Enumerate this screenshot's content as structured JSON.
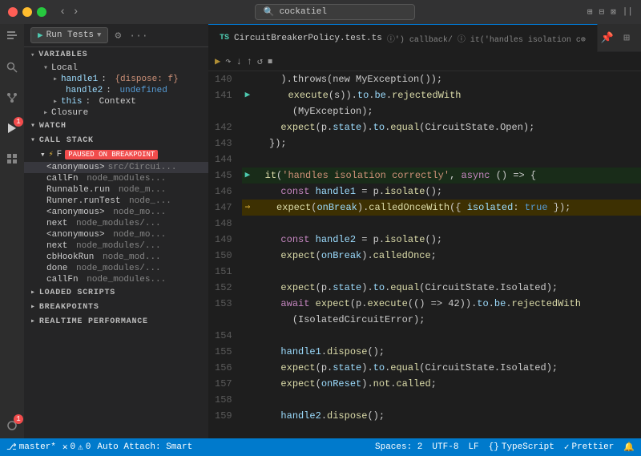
{
  "titleBar": {
    "searchPlaceholder": "cockatiel",
    "navBack": "‹",
    "navForward": "›"
  },
  "activityBar": {
    "icons": [
      {
        "name": "explorer-icon",
        "glyph": "⎇",
        "active": false
      },
      {
        "name": "search-icon",
        "glyph": "🔍",
        "active": false
      },
      {
        "name": "scm-icon",
        "glyph": "⑂",
        "active": false
      },
      {
        "name": "debug-icon",
        "glyph": "▷",
        "active": true
      },
      {
        "name": "extensions-icon",
        "glyph": "⬛",
        "active": false
      },
      {
        "name": "remote-icon",
        "glyph": "⌂",
        "active": false
      }
    ]
  },
  "sidebar": {
    "debugToolbar": {
      "runLabel": "Run Tests",
      "settingsIcon": "⚙",
      "moreIcon": "···"
    },
    "variables": {
      "header": "VARIABLES",
      "items": [
        {
          "label": "Local",
          "type": "group"
        },
        {
          "label": "handle1",
          "value": "{dispose: f}",
          "type": "var",
          "indent": 2
        },
        {
          "label": "handle2",
          "value": "undefined",
          "type": "var-undefined",
          "indent": 2
        },
        {
          "label": "this",
          "value": "Context",
          "type": "var",
          "indent": 2
        },
        {
          "label": "Closure",
          "type": "group",
          "indent": 1
        }
      ]
    },
    "watch": {
      "header": "WATCH"
    },
    "callStack": {
      "header": "CALL STACK",
      "thread": {
        "label": "F",
        "status": "PAUSED ON BREAKPOINT"
      },
      "frames": [
        {
          "name": "<anonymous>",
          "path": "src/Circui..."
        },
        {
          "name": "callFn",
          "path": "node_modules..."
        },
        {
          "name": "Runnable.run",
          "path": "node_m..."
        },
        {
          "name": "Runner.runTest",
          "path": "node_..."
        },
        {
          "name": "<anonymous>",
          "path": "node_mo..."
        },
        {
          "name": "next",
          "path": "node_modules/..."
        },
        {
          "name": "<anonymous>",
          "path": "node_mo..."
        },
        {
          "name": "next",
          "path": "node_modules/..."
        },
        {
          "name": "cbHookRun",
          "path": "node_mod..."
        },
        {
          "name": "done",
          "path": "node_modules/..."
        },
        {
          "name": "callFn",
          "path": "node_modules..."
        }
      ]
    },
    "loadedScripts": {
      "header": "LOADED SCRIPTS"
    },
    "breakpoints": {
      "header": "BREAKPOINTS"
    },
    "realtimePerformance": {
      "header": "REALTIME PERFORMANCE"
    }
  },
  "editor": {
    "tab": {
      "tsLabel": "TS",
      "filename": "CircuitBreakerPolicy.test.ts",
      "breadcrumb": "ⓘ') callback/ ⓘ it('handles isolation c⊕"
    },
    "debugToolbar": {
      "continue": "▶",
      "stepOver": "↷",
      "stepInto": "↓",
      "stepOut": "↑",
      "restart": "↺",
      "stop": "⏹"
    },
    "lines": [
      {
        "num": 140,
        "arrow": "",
        "content": [
          {
            "t": "op",
            "v": "    ).throws(new MyException());"
          }
        ]
      },
      {
        "num": 141,
        "arrow": "play",
        "content": [
          {
            "t": "fn",
            "v": "      execute"
          },
          {
            "t": "op",
            "v": "(s))."
          },
          {
            "t": "prop",
            "v": "to"
          },
          {
            "t": "op",
            "v": "."
          },
          {
            "t": "prop",
            "v": "be"
          },
          {
            "t": "op",
            "v": "."
          },
          {
            "t": "fn",
            "v": "rejectedWith"
          }
        ]
      },
      {
        "num": "",
        "arrow": "",
        "content": [
          {
            "t": "op",
            "v": "      (MyException);"
          }
        ]
      },
      {
        "num": 142,
        "arrow": "",
        "content": [
          {
            "t": "fn",
            "v": "    expect"
          },
          {
            "t": "op",
            "v": "(p."
          },
          {
            "t": "prop",
            "v": "state"
          },
          {
            "t": "op",
            "v": ")."
          },
          {
            "t": "prop",
            "v": "to"
          },
          {
            "t": "op",
            "v": "."
          },
          {
            "t": "fn",
            "v": "equal"
          },
          {
            "t": "op",
            "v": "(CircuitState.Open);"
          }
        ]
      },
      {
        "num": 143,
        "arrow": "",
        "content": [
          {
            "t": "op",
            "v": "  });"
          }
        ]
      },
      {
        "num": 144,
        "arrow": "",
        "content": [
          {
            "t": "op",
            "v": ""
          }
        ]
      },
      {
        "num": 145,
        "arrow": "play",
        "content": [
          {
            "t": "fn",
            "v": "  it"
          },
          {
            "t": "op",
            "v": "("
          },
          {
            "t": "str",
            "v": "'handles isolation correctly'"
          },
          {
            "t": "op",
            "v": ", "
          },
          {
            "t": "kw",
            "v": "async"
          },
          {
            "t": "op",
            "v": " () => {"
          }
        ],
        "highlight": "green"
      },
      {
        "num": 146,
        "arrow": "",
        "content": [
          {
            "t": "kw",
            "v": "    const"
          },
          {
            "t": "op",
            "v": " "
          },
          {
            "t": "var2",
            "v": "handle1"
          },
          {
            "t": "op",
            "v": " = p."
          },
          {
            "t": "fn",
            "v": "isolate"
          },
          {
            "t": "op",
            "v": "();"
          }
        ]
      },
      {
        "num": 147,
        "arrow": "debug",
        "content": [
          {
            "t": "fn",
            "v": "    expect"
          },
          {
            "t": "op",
            "v": "("
          },
          {
            "t": "var2",
            "v": "onBreak"
          },
          {
            "t": "op",
            "v": ")."
          },
          {
            "t": "fn",
            "v": "calledOnceWith"
          },
          {
            "t": "op",
            "v": "({ "
          },
          {
            "t": "prop",
            "v": "isolated"
          },
          {
            "t": "op",
            "v": ": "
          },
          {
            "t": "bool-val",
            "v": "true"
          },
          {
            "t": "op",
            "v": " });"
          }
        ],
        "highlight": "yellow"
      },
      {
        "num": 148,
        "arrow": "",
        "content": [
          {
            "t": "op",
            "v": ""
          }
        ]
      },
      {
        "num": 149,
        "arrow": "",
        "content": [
          {
            "t": "kw",
            "v": "    const"
          },
          {
            "t": "op",
            "v": " "
          },
          {
            "t": "var2",
            "v": "handle2"
          },
          {
            "t": "op",
            "v": " = p."
          },
          {
            "t": "fn",
            "v": "isolate"
          },
          {
            "t": "op",
            "v": "();"
          }
        ]
      },
      {
        "num": 150,
        "arrow": "",
        "content": [
          {
            "t": "fn",
            "v": "    expect"
          },
          {
            "t": "op",
            "v": "("
          },
          {
            "t": "var2",
            "v": "onBreak"
          },
          {
            "t": "op",
            "v": ")."
          },
          {
            "t": "fn",
            "v": "calledOnce"
          },
          {
            "t": "op",
            "v": ";"
          }
        ]
      },
      {
        "num": 151,
        "arrow": "",
        "content": [
          {
            "t": "op",
            "v": ""
          }
        ]
      },
      {
        "num": 152,
        "arrow": "",
        "content": [
          {
            "t": "fn",
            "v": "    expect"
          },
          {
            "t": "op",
            "v": "(p."
          },
          {
            "t": "prop",
            "v": "state"
          },
          {
            "t": "op",
            "v": ")."
          },
          {
            "t": "prop",
            "v": "to"
          },
          {
            "t": "op",
            "v": "."
          },
          {
            "t": "fn",
            "v": "equal"
          },
          {
            "t": "op",
            "v": "(CircuitState.Isolated);"
          }
        ]
      },
      {
        "num": 153,
        "arrow": "",
        "content": [
          {
            "t": "kw",
            "v": "    await"
          },
          {
            "t": "op",
            "v": " "
          },
          {
            "t": "fn",
            "v": "expect"
          },
          {
            "t": "op",
            "v": "(p."
          },
          {
            "t": "fn",
            "v": "execute"
          },
          {
            "t": "op",
            "v": "(() => 42))."
          },
          {
            "t": "prop",
            "v": "to"
          },
          {
            "t": "op",
            "v": "."
          },
          {
            "t": "prop",
            "v": "be"
          },
          {
            "t": "op",
            "v": "."
          },
          {
            "t": "fn",
            "v": "rejectedWith"
          }
        ]
      },
      {
        "num": "",
        "arrow": "",
        "content": [
          {
            "t": "op",
            "v": "      (IsolatedCircuitError);"
          }
        ]
      },
      {
        "num": 154,
        "arrow": "",
        "content": [
          {
            "t": "op",
            "v": ""
          }
        ]
      },
      {
        "num": 155,
        "arrow": "",
        "content": [
          {
            "t": "var2",
            "v": "    handle1"
          },
          {
            "t": "op",
            "v": "."
          },
          {
            "t": "fn",
            "v": "dispose"
          },
          {
            "t": "op",
            "v": "();"
          }
        ]
      },
      {
        "num": 156,
        "arrow": "",
        "content": [
          {
            "t": "fn",
            "v": "    expect"
          },
          {
            "t": "op",
            "v": "(p."
          },
          {
            "t": "prop",
            "v": "state"
          },
          {
            "t": "op",
            "v": ")."
          },
          {
            "t": "prop",
            "v": "to"
          },
          {
            "t": "op",
            "v": "."
          },
          {
            "t": "fn",
            "v": "equal"
          },
          {
            "t": "op",
            "v": "(CircuitState.Isolated);"
          }
        ]
      },
      {
        "num": 157,
        "arrow": "",
        "content": [
          {
            "t": "fn",
            "v": "    expect"
          },
          {
            "t": "op",
            "v": "("
          },
          {
            "t": "var2",
            "v": "onReset"
          },
          {
            "t": "op",
            "v": ")."
          },
          {
            "t": "fn",
            "v": "not"
          },
          {
            "t": "op",
            "v": "."
          },
          {
            "t": "fn",
            "v": "called"
          },
          {
            "t": "op",
            "v": ";"
          }
        ]
      },
      {
        "num": 158,
        "arrow": "",
        "content": [
          {
            "t": "op",
            "v": ""
          }
        ]
      },
      {
        "num": 159,
        "arrow": "",
        "content": [
          {
            "t": "var2",
            "v": "    handle2"
          },
          {
            "t": "op",
            "v": "."
          },
          {
            "t": "fn",
            "v": "dispose"
          },
          {
            "t": "op",
            "v": "();"
          }
        ]
      }
    ]
  },
  "statusBar": {
    "branch": "master*",
    "errors": "0",
    "warnings": "0",
    "autoAttach": "Auto Attach: Smart",
    "spaces": "Spaces: 2",
    "encoding": "UTF-8",
    "lineEnding": "LF",
    "language": "TypeScript",
    "prettier": "Prettier"
  }
}
